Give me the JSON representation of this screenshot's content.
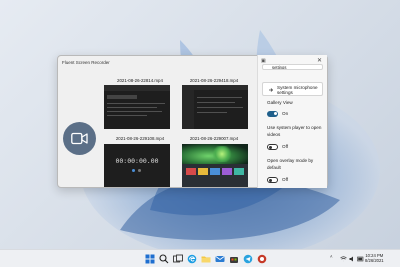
{
  "window": {
    "title": "Fluent Screen Recorder"
  },
  "recordings": [
    {
      "label": "2021-08-26-22814.mp4"
    },
    {
      "label": "2021-08-26-229418.mp4"
    },
    {
      "label": "2021-08-26-229108.mp4",
      "timer": "00:00:00.00"
    },
    {
      "label": "2021-08-26-229007.mp4"
    }
  ],
  "settings": {
    "top_item_label": "settings",
    "microphone_button": "System microphone settings",
    "gallery_view": {
      "label": "Gallery View",
      "state": "On"
    },
    "system_player": {
      "label": "Use system player to open videos",
      "state": "Off"
    },
    "overlay_mode": {
      "label": "Open overlay mode by default",
      "state": "Off"
    }
  },
  "taskbar": {
    "clock_time": "10:24 PM",
    "clock_date": "8/26/2021"
  },
  "colors": {
    "accent": "#1f5f8b",
    "record_button": "#5b6f87",
    "taskbar": "#eef0f3"
  }
}
